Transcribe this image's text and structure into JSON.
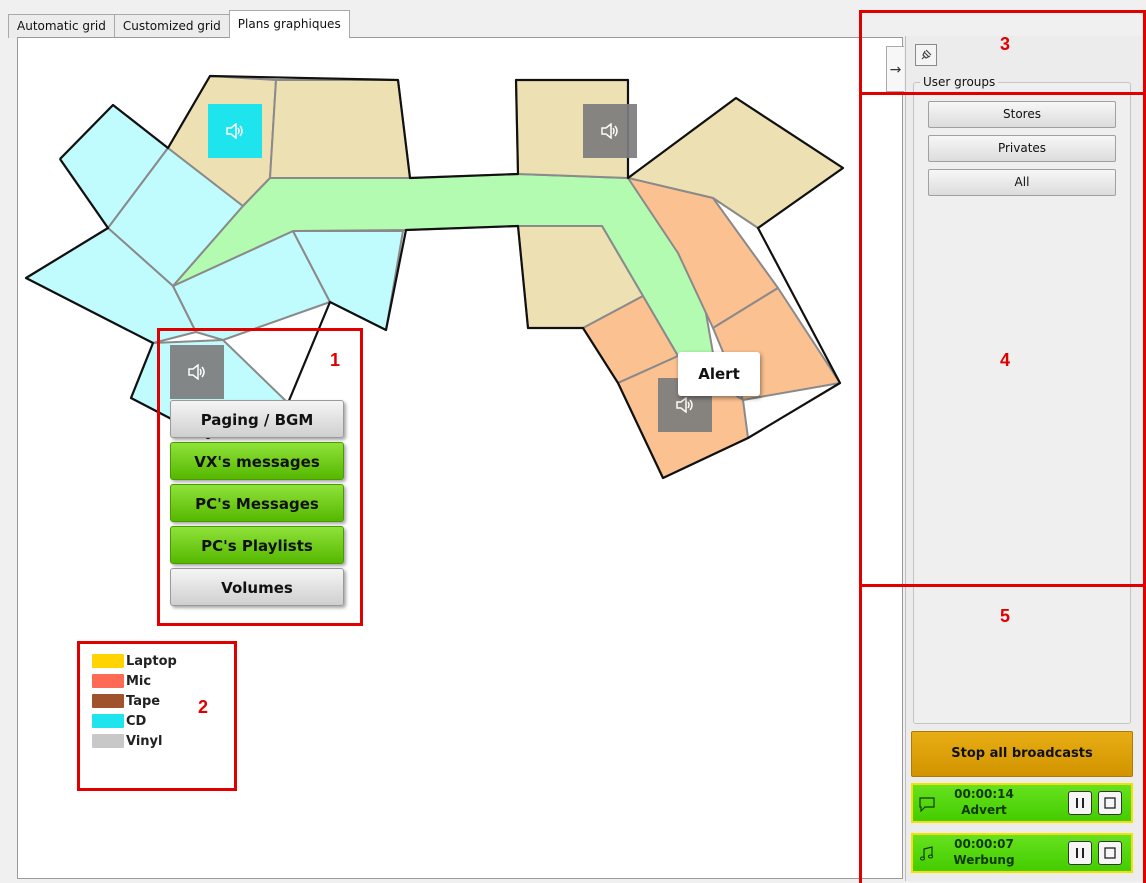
{
  "tabs": [
    "Automatic grid",
    "Customized grid",
    "Plans graphiques"
  ],
  "active_tab": "Plans graphiques",
  "popup_menu": {
    "buttons": [
      "Paging / BGM",
      "VX's messages",
      "PC's Messages",
      "PC's Playlists",
      "Volumes"
    ]
  },
  "alert_label": "Alert",
  "legend": [
    {
      "label": "Laptop",
      "color": "#ffd400"
    },
    {
      "label": "Mic",
      "color": "#ff6a55"
    },
    {
      "label": "Tape",
      "color": "#a0522d"
    },
    {
      "label": "CD",
      "color": "#1ee4ee"
    },
    {
      "label": "Vinyl",
      "color": "#c8c8c8"
    }
  ],
  "annotations": [
    "1",
    "2",
    "3",
    "4",
    "5"
  ],
  "right_panel": {
    "groups_title": "User groups",
    "group_buttons": [
      "Stores",
      "Privates",
      "All"
    ],
    "stop_all": "Stop all broadcasts",
    "broadcasts": [
      {
        "time": "00:00:14",
        "name": "Advert",
        "icon": "message-icon"
      },
      {
        "time": "00:00:07",
        "name": "Werbung",
        "icon": "music-note-icon"
      }
    ]
  },
  "colors": {
    "zone_cyan": "#c0fbfd",
    "zone_beige": "#ede0b2",
    "zone_green": "#b3fbb0",
    "zone_orange": "#fbc191",
    "annotation_red": "#e00000"
  }
}
